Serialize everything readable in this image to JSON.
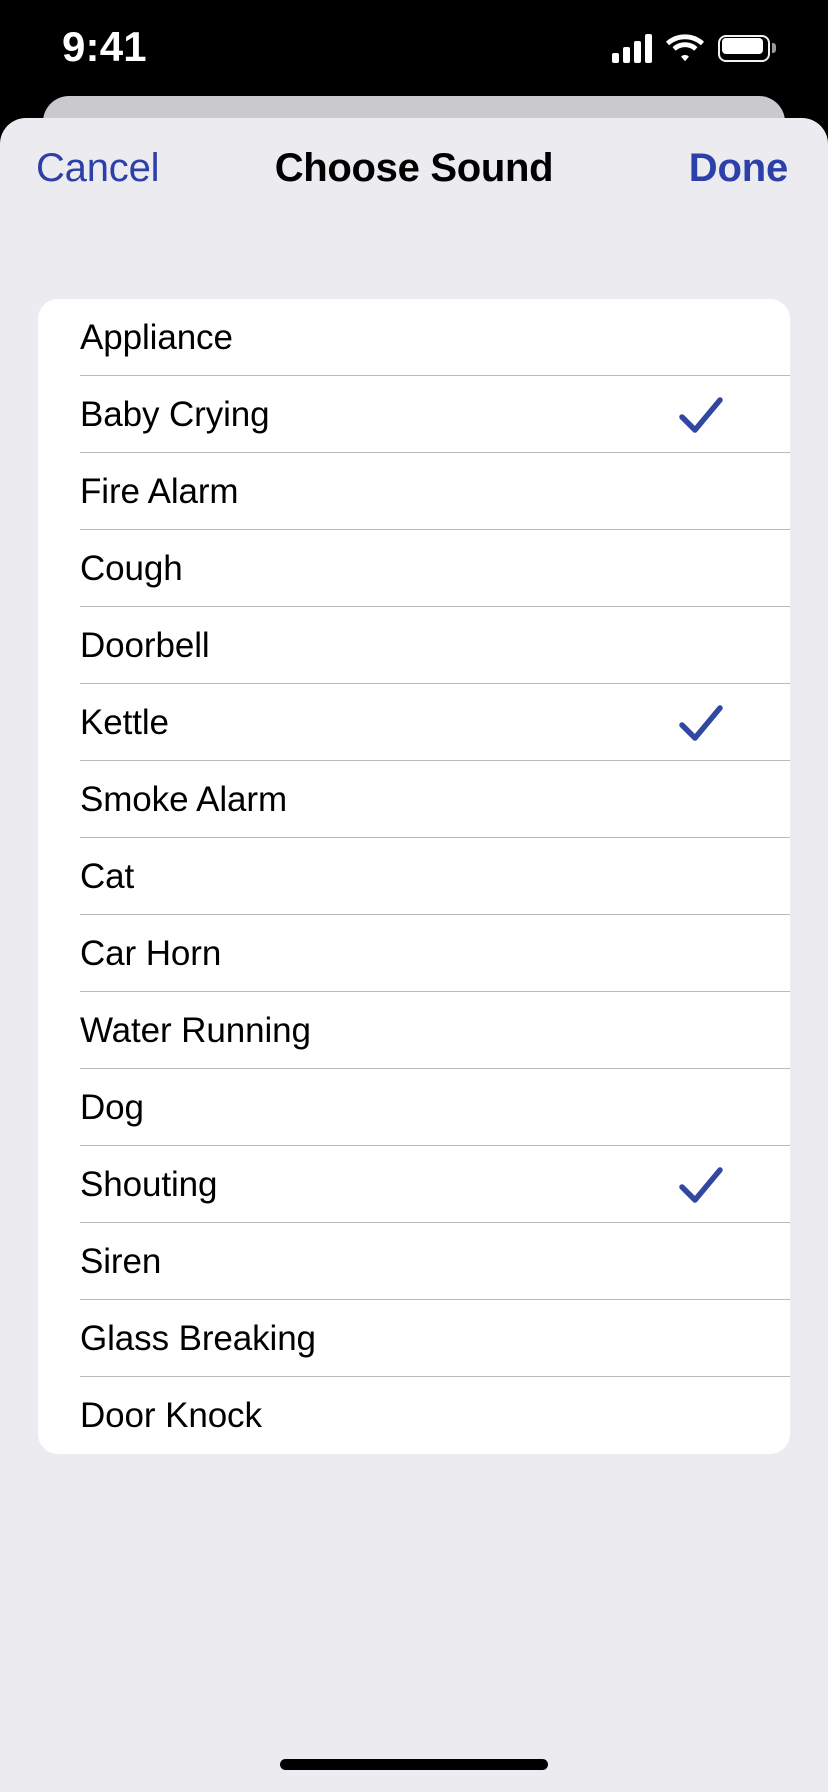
{
  "status_bar": {
    "time": "9:41",
    "cellular_icon": "signal-bars-icon",
    "wifi_icon": "wifi-icon",
    "battery_icon": "battery-full-icon"
  },
  "nav": {
    "cancel_label": "Cancel",
    "title": "Choose Sound",
    "done_label": "Done"
  },
  "colors": {
    "accent_blue": "#2d3fa8",
    "checkmark_blue": "#32479f",
    "sheet_background": "#ececf0",
    "sheet_back_card": "#c9c9ce",
    "card_white": "#ffffff",
    "separator": "#b9b9bb",
    "text_primary": "#000000"
  },
  "sound_list": {
    "items": [
      {
        "label": "Appliance",
        "selected": false
      },
      {
        "label": "Baby Crying",
        "selected": true
      },
      {
        "label": "Fire Alarm",
        "selected": false
      },
      {
        "label": "Cough",
        "selected": false
      },
      {
        "label": "Doorbell",
        "selected": false
      },
      {
        "label": "Kettle",
        "selected": true
      },
      {
        "label": "Smoke Alarm",
        "selected": false
      },
      {
        "label": "Cat",
        "selected": false
      },
      {
        "label": "Car Horn",
        "selected": false
      },
      {
        "label": "Water Running",
        "selected": false
      },
      {
        "label": "Dog",
        "selected": false
      },
      {
        "label": "Shouting",
        "selected": true
      },
      {
        "label": "Siren",
        "selected": false
      },
      {
        "label": "Glass Breaking",
        "selected": false
      },
      {
        "label": "Door Knock",
        "selected": false
      }
    ]
  },
  "home_indicator": "home-indicator"
}
